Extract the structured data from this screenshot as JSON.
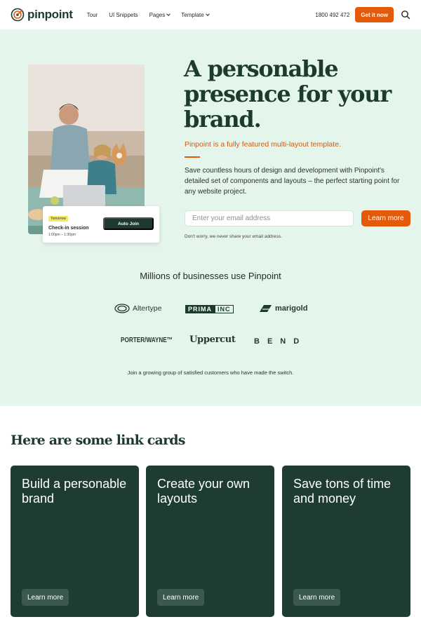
{
  "brand": {
    "name": "pinpoint",
    "accent": "#e35b0a",
    "dark": "#1e3d30",
    "hero_bg": "#e4f5ec"
  },
  "nav": {
    "items": [
      {
        "label": "Tour"
      },
      {
        "label": "UI Snippets"
      },
      {
        "label": "Pages"
      },
      {
        "label": "Template"
      }
    ],
    "phone": "1800 492 472",
    "cta": "Get it now"
  },
  "hero": {
    "headline": "A personable presence for your brand.",
    "tagline": "Pinpoint is a fully featured multi-layout template.",
    "description": "Save countless hours of design and development with Pinpoint's detailed set of components and layouts – the perfect starting point for any website project.",
    "email_placeholder": "Enter your email address",
    "button": "Learn more",
    "disclaimer": "Don't worry, we never share your email address.",
    "session": {
      "badge": "Tomorrow",
      "title": "Check-in session",
      "time": "1:00pm – 1:30pm",
      "button": "Auto Join"
    }
  },
  "businesses": {
    "heading": "Millions of businesses use Pinpoint",
    "logos": [
      "Altertype",
      "PRIMA",
      "INC",
      "marigold",
      "PORTER/WAYNE™",
      "Uppercut",
      "BEND"
    ],
    "footer": "Join a growing group of satisfied customers who have made the switch."
  },
  "link_cards": {
    "title": "Here are some link cards",
    "cards": [
      {
        "title": "Build a personable brand",
        "button": "Learn more"
      },
      {
        "title": "Create your own layouts",
        "button": "Learn more"
      },
      {
        "title": "Save tons of time and money",
        "button": "Learn more"
      }
    ]
  }
}
